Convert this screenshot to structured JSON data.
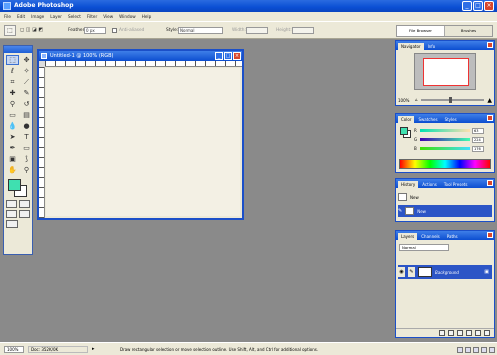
{
  "app": {
    "title": "Adobe Photoshop",
    "window_buttons": [
      "_",
      "□",
      "×"
    ]
  },
  "menu": [
    "File",
    "Edit",
    "Image",
    "Layer",
    "Select",
    "Filter",
    "View",
    "Window",
    "Help"
  ],
  "options": {
    "feather_label": "Feather:",
    "feather_value": "0 px",
    "antialias_label": "Anti-aliased",
    "style_label": "Style:",
    "style_value": "Normal",
    "width_label": "Width:",
    "height_label": "Height:",
    "palette_well_tabs": [
      "File Browser",
      "Brushes"
    ]
  },
  "document": {
    "title": "Untitled-1 @ 100% (RGB)"
  },
  "navigator": {
    "tabs": [
      "Navigator",
      "Info"
    ],
    "zoom": "100%",
    "zoom_level": 0.45
  },
  "color": {
    "tabs": [
      "Color",
      "Swatches",
      "Styles"
    ],
    "sliders": [
      {
        "label": "R",
        "value": "63",
        "gradient": "linear-gradient(90deg,#00e0b0,#ffe0b0)"
      },
      {
        "label": "G",
        "value": "224",
        "gradient": "linear-gradient(90deg,#3f00b0,#3fffb0)"
      },
      {
        "label": "B",
        "value": "176",
        "gradient": "linear-gradient(90deg,#3fe000,#3fe0ff)"
      }
    ],
    "foreground": "#3fe0b0",
    "background": "#ffffff"
  },
  "history": {
    "tabs": [
      "History",
      "Actions",
      "Tool Presets"
    ],
    "items": [
      "New",
      "New"
    ]
  },
  "layers": {
    "tabs": [
      "Layers",
      "Channels",
      "Paths"
    ],
    "blend_mode": "Normal",
    "layer_name": "Background"
  },
  "status": {
    "zoom": "100%",
    "doc_size": "Doc: 352K/0K",
    "message": "Draw rectangular selection or move selection outline. Use Shift, Alt, and Ctrl for additional options."
  },
  "colors": {
    "titlebar": "#0b4fd4",
    "workspace": "#8a8a8a",
    "chrome": "#ece9d8"
  }
}
